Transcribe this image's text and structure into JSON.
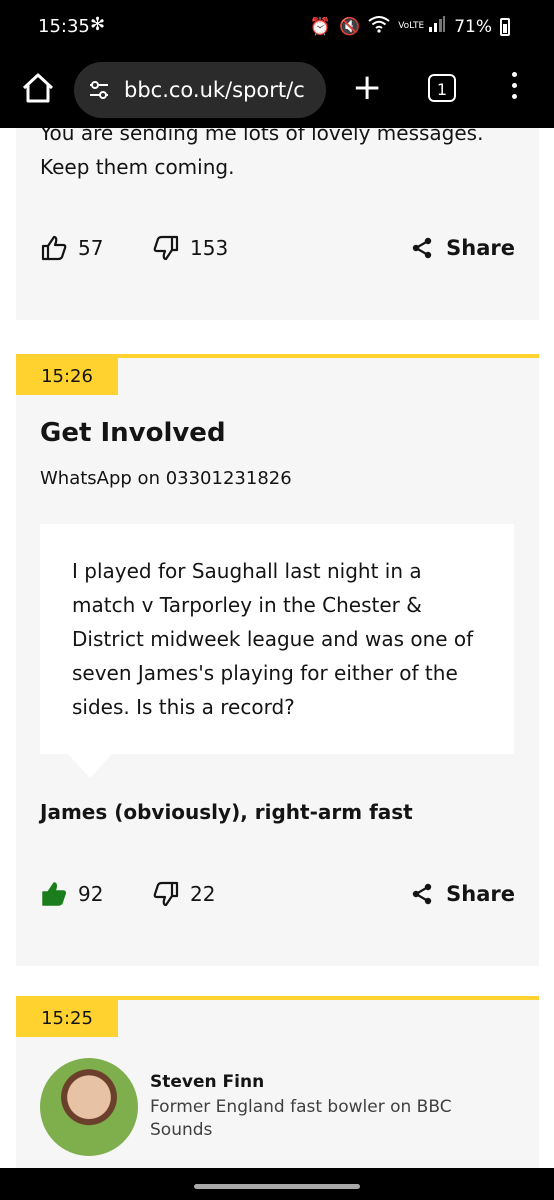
{
  "status_bar": {
    "time": "15:35",
    "right_icons": [
      "alarm-icon",
      "mute-icon",
      "wifi-icon",
      "volte-icon",
      "signal-icon"
    ],
    "volte_label": "VoLTE",
    "battery": "71%"
  },
  "browser": {
    "url": "bbc.co.uk/sport/c",
    "tab_count": "1"
  },
  "feed": {
    "posts": [
      {
        "text": "You are sending me lots of lovely messages. Keep them coming.",
        "likes": "57",
        "dislikes": "153",
        "share_label": "Share"
      },
      {
        "time": "15:26",
        "title": "Get Involved",
        "subtitle": "WhatsApp on 03301231826",
        "quote": "I played for Saughall last night in a match v Tarporley in the Chester & District midweek league and was one of seven James's playing for either of the sides. Is this a record?",
        "author": "James (obviously), right-arm fast",
        "likes": "92",
        "dislikes": "22",
        "share_label": "Share",
        "liked": true
      },
      {
        "time": "15:25",
        "person_name": "Steven Finn",
        "person_role": "Former England fast bowler on BBC Sounds"
      }
    ]
  },
  "colors": {
    "accent_yellow": "#ffd230",
    "liked_green": "#1b7d1b",
    "card_bg": "#f6f6f6"
  }
}
